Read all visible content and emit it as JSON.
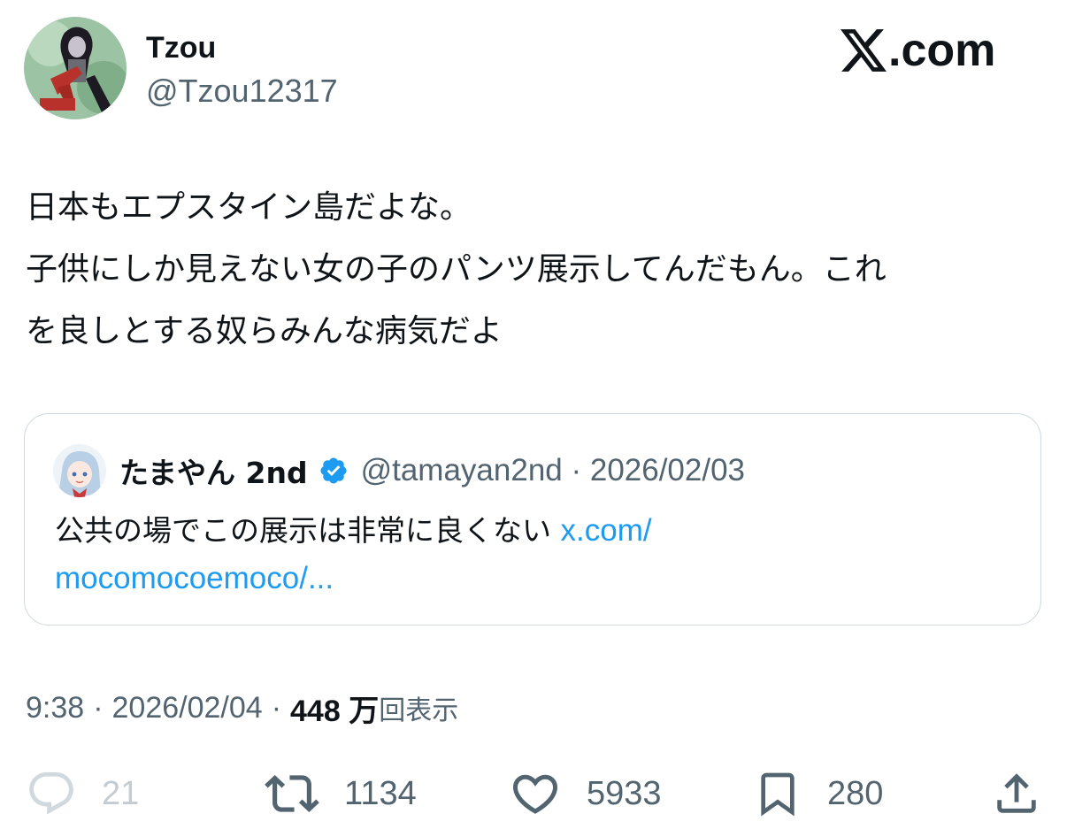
{
  "author": {
    "display_name": "Tzou",
    "handle": "@Tzou12317",
    "avatar_icon": "user-avatar"
  },
  "brand": {
    "logo_icon": "x-logo-icon",
    "text": ".com"
  },
  "tweet": {
    "lines": [
      "日本もエプスタイン島だよな。",
      "子供にしか見えない女の子のパンツ展示してんだもん。これ",
      "を良しとする奴らみんな病気だよ"
    ]
  },
  "quote": {
    "display_name": "たまやん 2nd",
    "verified_icon": "verified-badge-icon",
    "handle_date": "@tamayan2nd · 2026/02/03",
    "text_line1": "公共の場でこの展示は非常に良くない",
    "link_part1": "x.com/",
    "link_part2": "mocomocoemoco/..."
  },
  "meta": {
    "time": "9:38",
    "separator": "·",
    "date": "2026/02/04",
    "views_count": "448 万",
    "views_label": "回表示"
  },
  "actions": {
    "replies": "21",
    "reposts": "1134",
    "likes": "5933",
    "bookmarks": "280"
  },
  "colors": {
    "text_primary": "#0f1419",
    "text_secondary": "#536471",
    "link": "#1d9bf0",
    "border": "#cfd9de",
    "verified": "#1d9bf0"
  }
}
